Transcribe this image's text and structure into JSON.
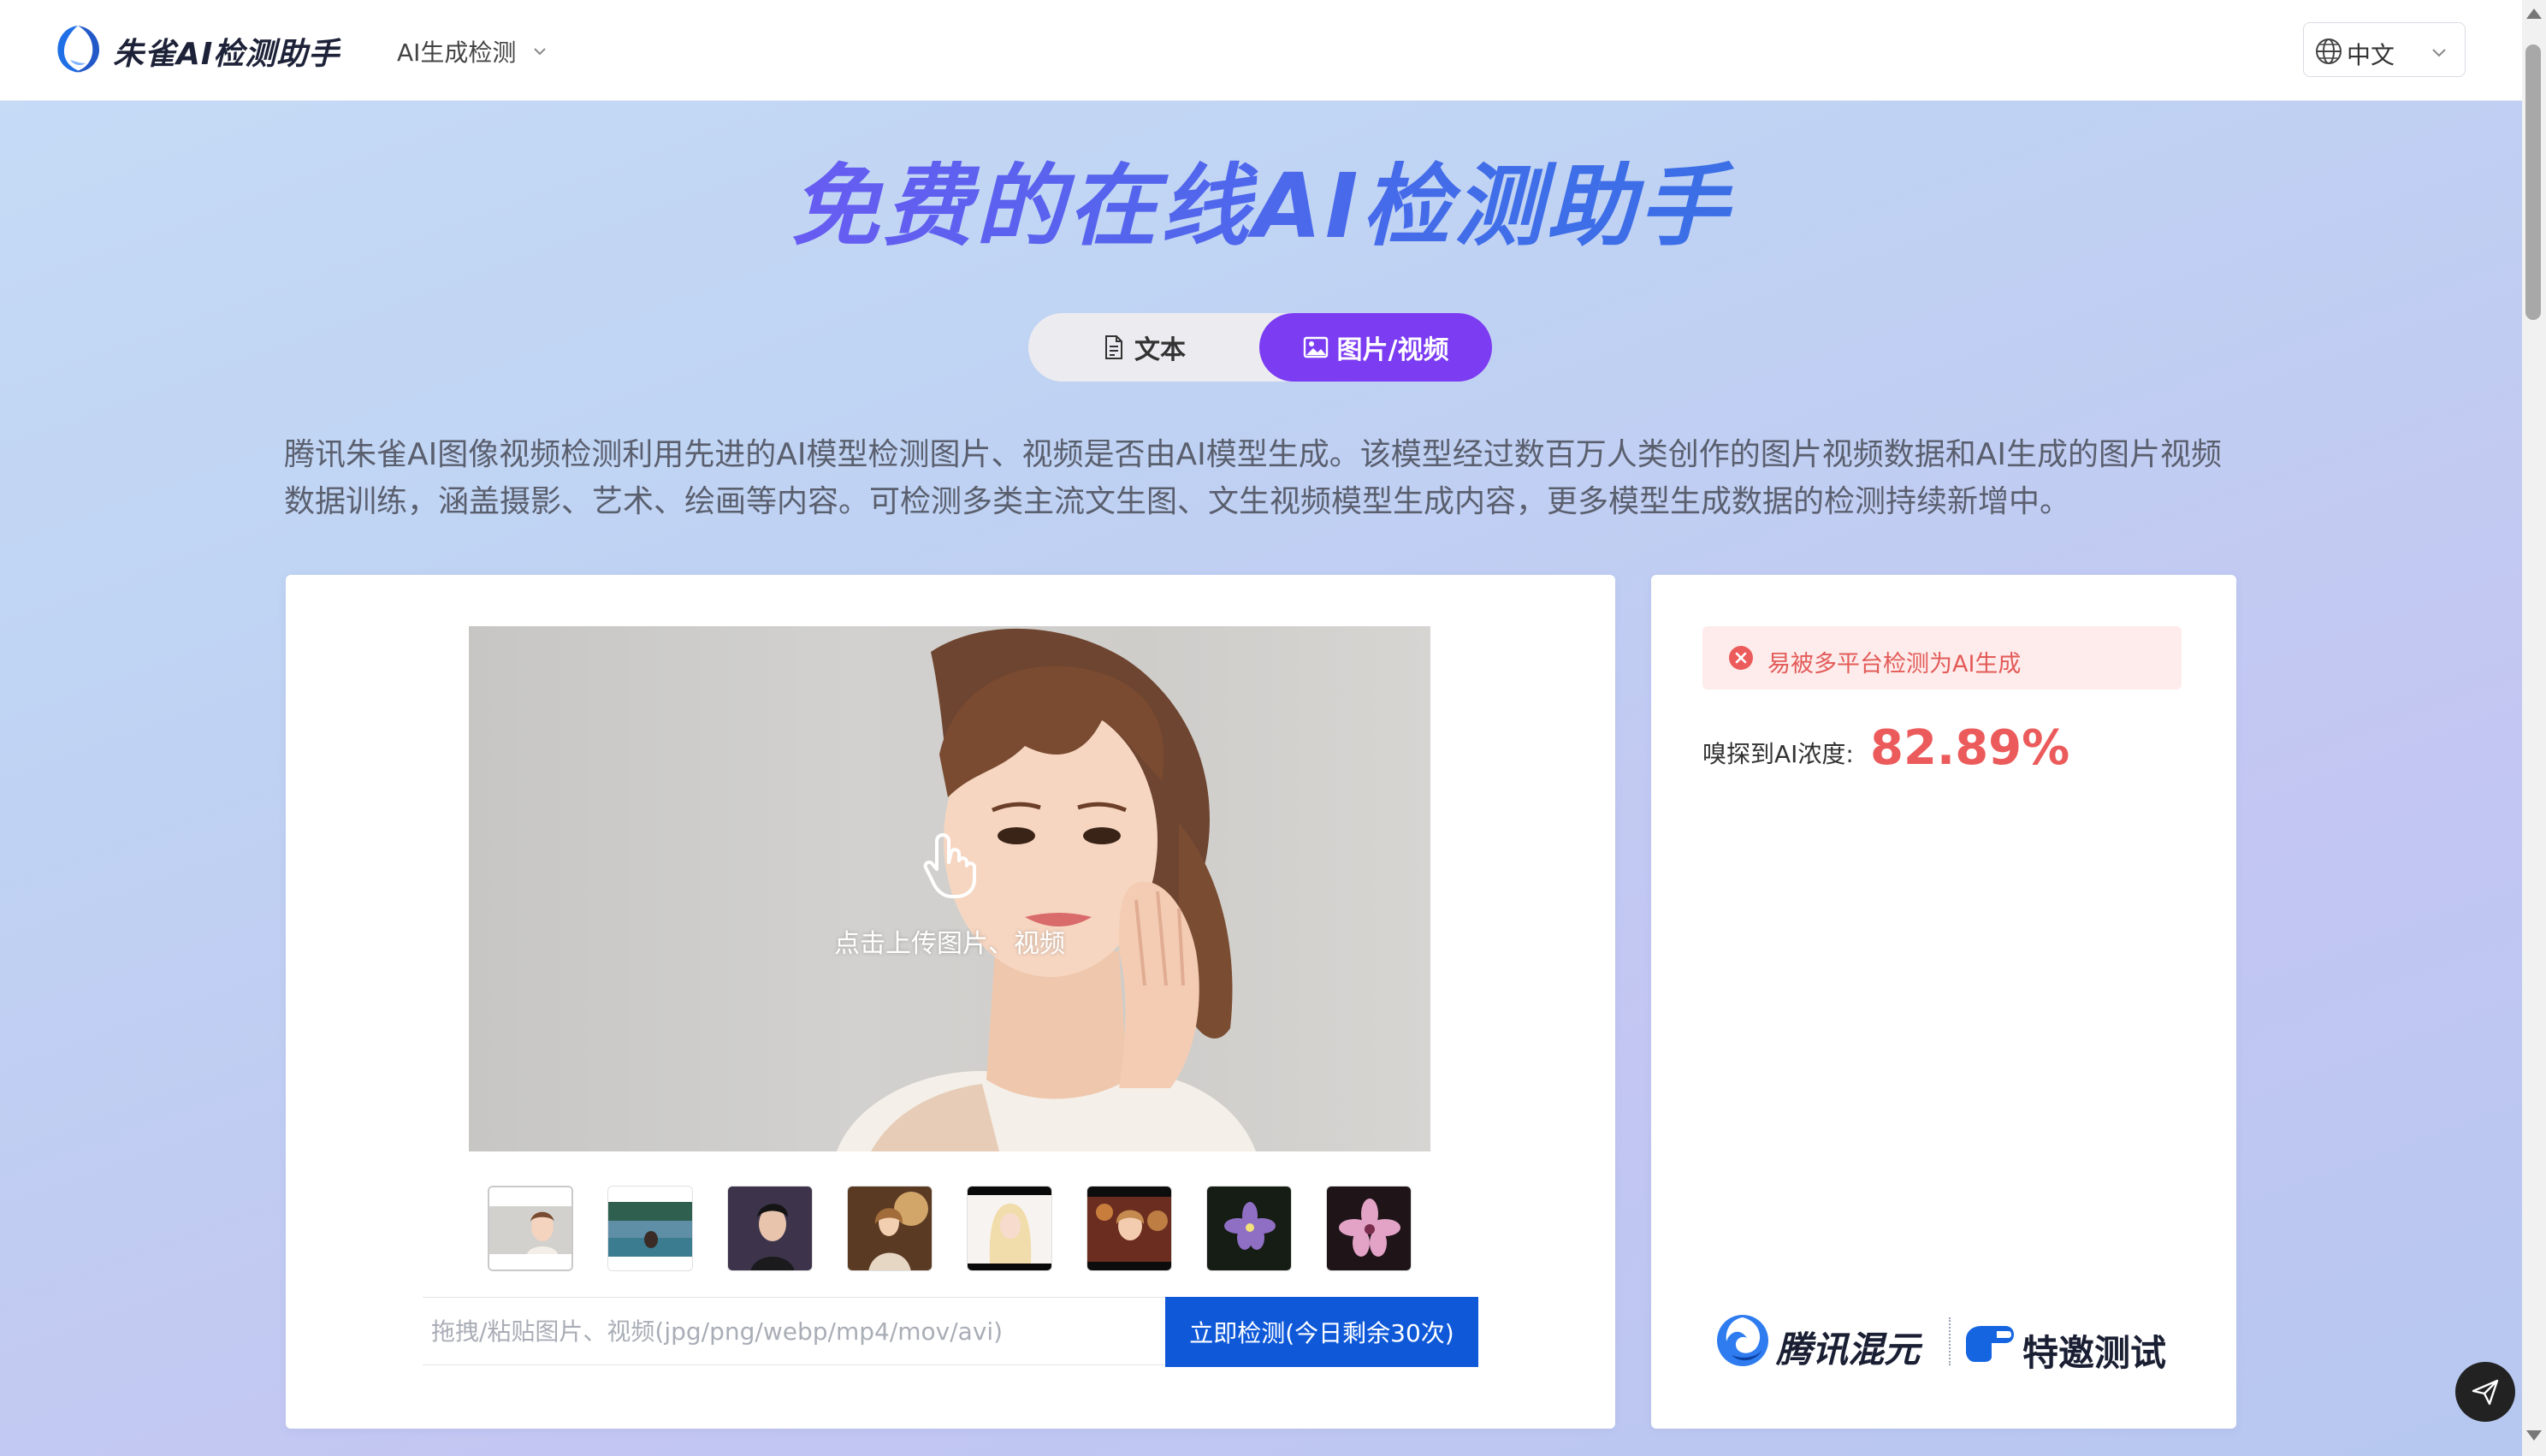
{
  "header": {
    "logo_text": "朱雀AI检测助手",
    "nav_menu_label": "AI生成检测",
    "language": "中文"
  },
  "hero": {
    "title": "免费的在线AI检测助手",
    "tabs": [
      {
        "label": "文本",
        "icon": "document-icon",
        "active": false
      },
      {
        "label": "图片/视频",
        "icon": "image-icon",
        "active": true
      }
    ],
    "description": "腾讯朱雀AI图像视频检测利用先进的AI模型检测图片、视频是否由AI模型生成。该模型经过数百万人类创作的图片视频数据和AI生成的图片视频数据训练，涵盖摄影、艺术、绘画等内容。可检测多类主流文生图、文生视频模型生成内容，更多模型生成数据的检测持续新增中。"
  },
  "upload": {
    "hint": "点击上传图片、视频",
    "sample_thumbnails": [
      "woman-portrait",
      "woman-lake",
      "man-portrait",
      "woman-warm-light",
      "woman-blonde",
      "woman-smiling",
      "purple-flower",
      "pink-flower"
    ],
    "input_placeholder": "拖拽/粘贴图片、视频(jpg/png/webp/mp4/mov/avi)",
    "input_value": "",
    "detect_button": "立即检测(今日剩余30次)"
  },
  "result": {
    "alert_text": "易被多平台检测为AI生成",
    "score_label": "嗅探到AI浓度:",
    "score_value": "82.89%",
    "brand_hunyuan": "腾讯混元",
    "brand_invite": "特邀测试"
  },
  "colors": {
    "accent_purple": "#7b3cf2",
    "button_blue": "#0f59d9",
    "alert_red": "#e35b59",
    "score_red": "#ec5b5b"
  }
}
